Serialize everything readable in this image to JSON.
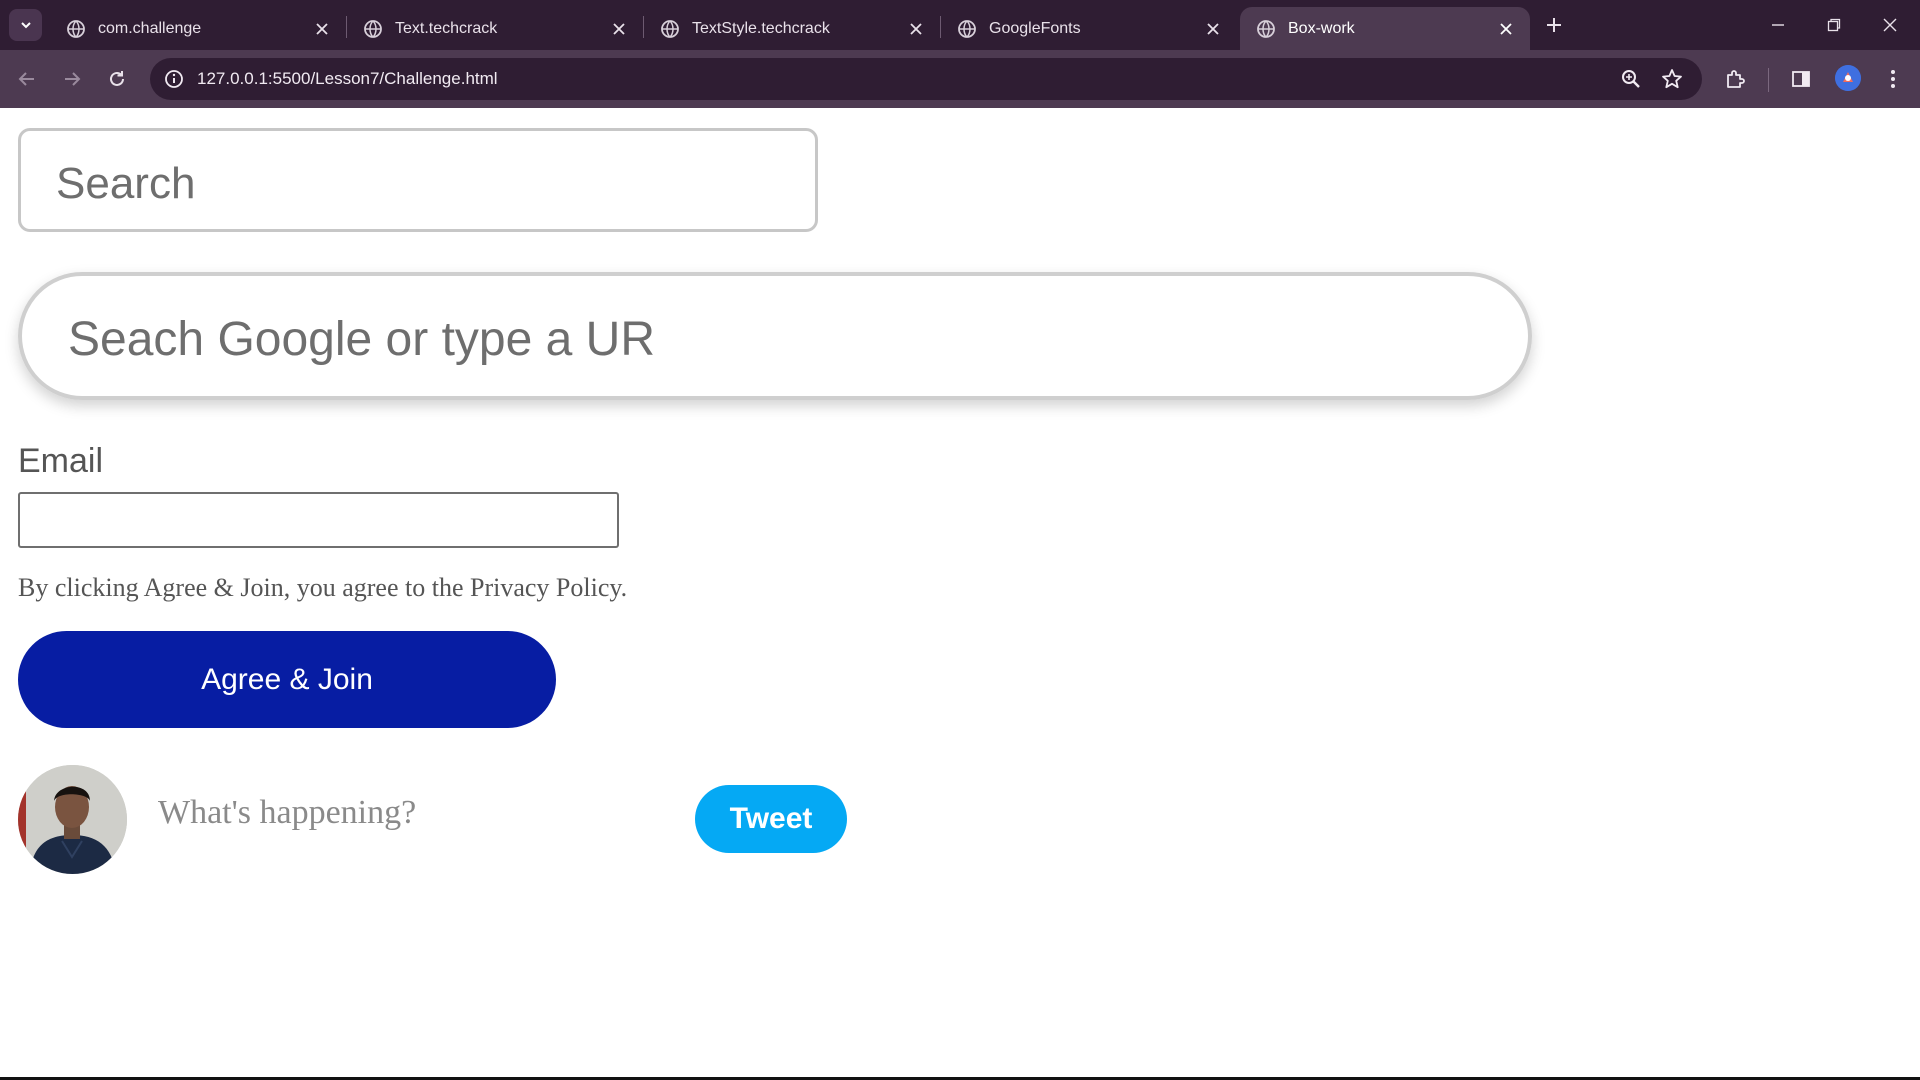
{
  "browser": {
    "tabs": [
      {
        "title": "com.challenge",
        "active": false
      },
      {
        "title": "Text.techcrack",
        "active": false
      },
      {
        "title": "TextStyle.techcrack",
        "active": false
      },
      {
        "title": "GoogleFonts",
        "active": false
      },
      {
        "title": "Box-work",
        "active": true
      }
    ],
    "url": "127.0.0.1:5500/Lesson7/Challenge.html",
    "colors": {
      "tabstrip": "#2f1d33",
      "toolbar": "#4d3a51"
    }
  },
  "page": {
    "search_placeholder": "Search",
    "google_search_placeholder": "Seach Google or type a UR",
    "email_label": "Email",
    "email_value": "",
    "privacy_text": "By clicking Agree & Join, you agree to the Privacy Policy.",
    "agree_button": "Agree & Join",
    "tweet_placeholder": "What's happening?",
    "tweet_button": "Tweet",
    "colors": {
      "agree_button": "#071da3",
      "tweet_button": "#05a9f4"
    }
  }
}
